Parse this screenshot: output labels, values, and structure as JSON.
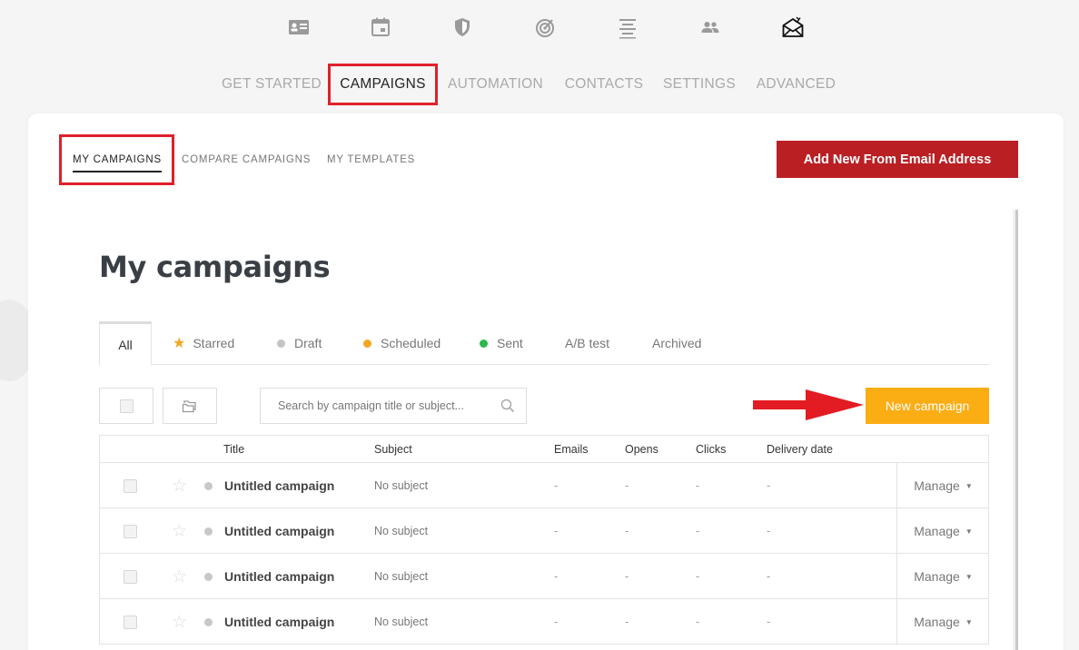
{
  "icon_nav": [
    {
      "name": "dashboard-icon",
      "active": false
    },
    {
      "name": "calendar-icon",
      "active": false
    },
    {
      "name": "shield-icon",
      "active": false
    },
    {
      "name": "target-icon",
      "active": false
    },
    {
      "name": "align-center-icon",
      "active": false
    },
    {
      "name": "users-icon",
      "active": false
    },
    {
      "name": "envelope-icon",
      "active": true
    }
  ],
  "main_menu": [
    "GET STARTED",
    "CAMPAIGNS",
    "AUTOMATION",
    "CONTACTS",
    "SETTINGS",
    "ADVANCED"
  ],
  "main_menu_active": "CAMPAIGNS",
  "sub_tabs": [
    "MY CAMPAIGNS",
    "COMPARE CAMPAIGNS",
    "MY TEMPLATES"
  ],
  "add_email_button": "Add New From Email Address",
  "page_title": "My campaigns",
  "filter_tabs": [
    {
      "label": "All",
      "marker": "none"
    },
    {
      "label": "Starred",
      "marker": "star"
    },
    {
      "label": "Draft",
      "marker": "dot",
      "color": "#c4c4c4"
    },
    {
      "label": "Scheduled",
      "marker": "dot",
      "color": "#f5a623"
    },
    {
      "label": "Sent",
      "marker": "dot",
      "color": "#2db84c"
    },
    {
      "label": "A/B test",
      "marker": "none"
    },
    {
      "label": "Archived",
      "marker": "none"
    }
  ],
  "search": {
    "placeholder": "Search by campaign title or subject..."
  },
  "new_campaign_button": "New campaign",
  "table": {
    "headers": [
      "Title",
      "Subject",
      "Emails",
      "Opens",
      "Clicks",
      "Delivery date"
    ],
    "rows": [
      {
        "title": "Untitled campaign",
        "subject": "No subject",
        "emails": "-",
        "opens": "-",
        "clicks": "-",
        "delivery": "-",
        "action": "Manage"
      },
      {
        "title": "Untitled campaign",
        "subject": "No subject",
        "emails": "-",
        "opens": "-",
        "clicks": "-",
        "delivery": "-",
        "action": "Manage"
      },
      {
        "title": "Untitled campaign",
        "subject": "No subject",
        "emails": "-",
        "opens": "-",
        "clicks": "-",
        "delivery": "-",
        "action": "Manage"
      },
      {
        "title": "Untitled campaign",
        "subject": "No subject",
        "emails": "-",
        "opens": "-",
        "clicks": "-",
        "delivery": "-",
        "action": "Manage"
      }
    ]
  },
  "colors": {
    "accent_red": "#b91f23",
    "highlight_red": "#e0202a",
    "new_button": "#fbad14"
  }
}
